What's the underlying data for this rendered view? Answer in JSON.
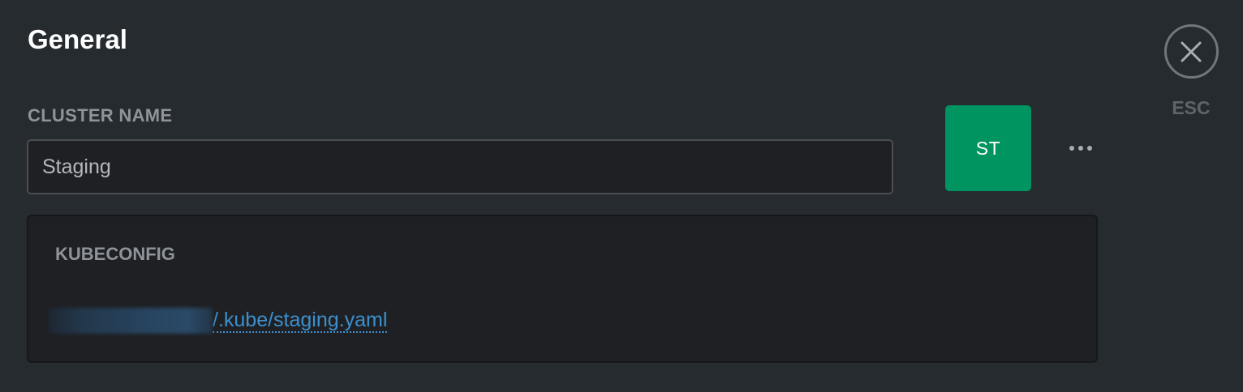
{
  "header": {
    "title": "General"
  },
  "cluster_name": {
    "label": "CLUSTER NAME",
    "value": "Staging"
  },
  "avatar": {
    "initials": "ST",
    "color": "#009460"
  },
  "more_menu": {
    "icon": "more-horizontal-icon"
  },
  "close": {
    "icon": "close-icon",
    "label": "ESC"
  },
  "kubeconfig": {
    "label": "KUBECONFIG",
    "path": "/.kube/staging.yaml",
    "link_color": "#3d90ce"
  }
}
